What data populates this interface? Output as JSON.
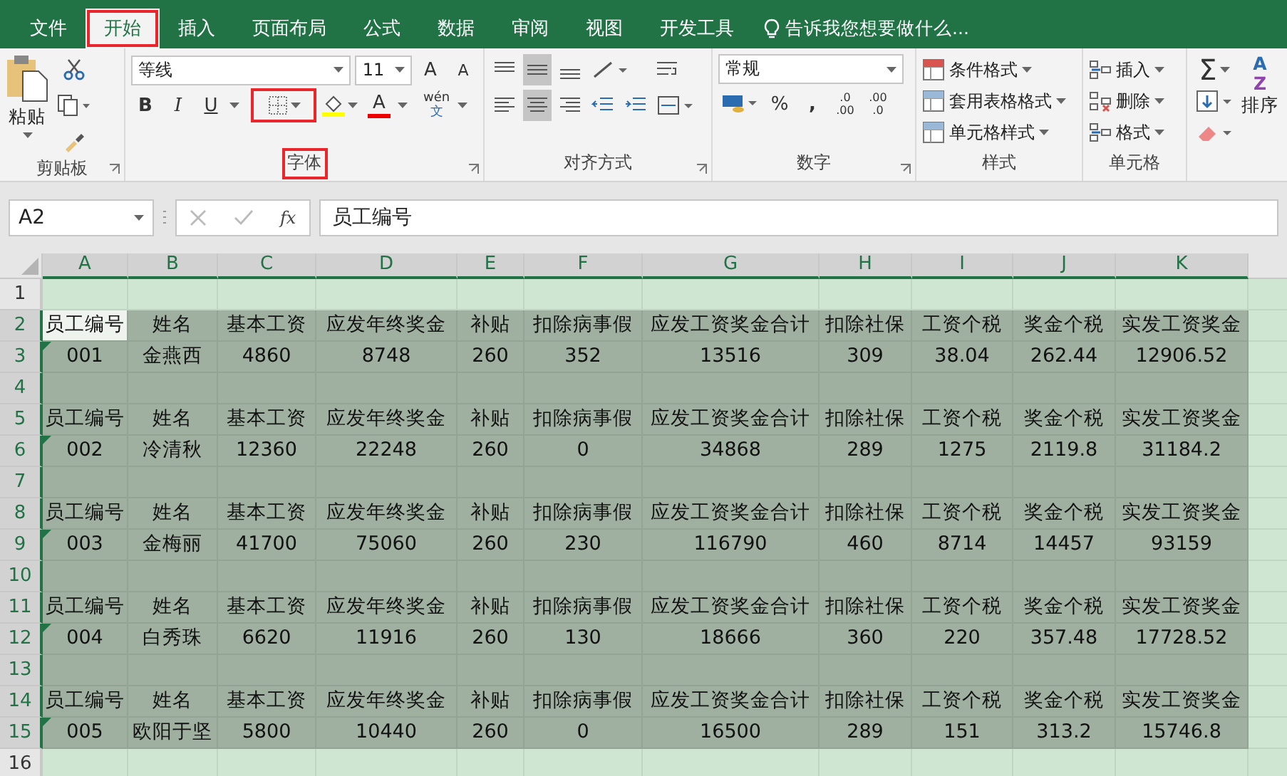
{
  "tabs": [
    {
      "label": "文件",
      "selected": false,
      "highlighted": false
    },
    {
      "label": "开始",
      "selected": true,
      "highlighted": true
    },
    {
      "label": "插入",
      "selected": false,
      "highlighted": false
    },
    {
      "label": "页面布局",
      "selected": false,
      "highlighted": false
    },
    {
      "label": "公式",
      "selected": false,
      "highlighted": false
    },
    {
      "label": "数据",
      "selected": false,
      "highlighted": false
    },
    {
      "label": "审阅",
      "selected": false,
      "highlighted": false
    },
    {
      "label": "视图",
      "selected": false,
      "highlighted": false
    },
    {
      "label": "开发工具",
      "selected": false,
      "highlighted": false
    }
  ],
  "tell_me": "告诉我您想要做什么...",
  "ribbon": {
    "clipboard": {
      "paste": "粘贴",
      "label": "剪贴板"
    },
    "font": {
      "name": "等线",
      "size": "11",
      "grow": "A",
      "shrink": "A",
      "bold": "B",
      "italic": "I",
      "underline": "U",
      "color_letter": "A",
      "phonetic_top": "wén",
      "phonetic_bottom": "文",
      "label": "字体",
      "label_highlighted": true,
      "border_highlighted": true
    },
    "alignment": {
      "label": "对齐方式"
    },
    "number": {
      "format": "常规",
      "percent": "%",
      "comma": ",",
      "increase_decimal": [
        ".0",
        ".00"
      ],
      "decrease_decimal": [
        ".00",
        ".0"
      ],
      "label": "数字"
    },
    "styles": {
      "items": [
        "条件格式",
        "套用表格格式",
        "单元格样式"
      ],
      "label": "样式"
    },
    "cells": {
      "items": [
        "插入",
        "删除",
        "格式"
      ],
      "label": "单元格"
    },
    "editing": {
      "sum": "Σ",
      "sort_icon": [
        "A",
        "Z"
      ],
      "sort": "排序"
    }
  },
  "formula_bar": {
    "name_box": "A2",
    "fx": "fx",
    "value": "员工编号"
  },
  "sheet": {
    "columns": [
      {
        "label": "A",
        "selected": true
      },
      {
        "label": "B",
        "selected": true
      },
      {
        "label": "C",
        "selected": true
      },
      {
        "label": "D",
        "selected": true
      },
      {
        "label": "E",
        "selected": true
      },
      {
        "label": "F",
        "selected": true
      },
      {
        "label": "G",
        "selected": true
      },
      {
        "label": "H",
        "selected": true
      },
      {
        "label": "I",
        "selected": true
      },
      {
        "label": "J",
        "selected": true
      },
      {
        "label": "K",
        "selected": true
      }
    ],
    "rows": [
      {
        "number": "1",
        "selected": false,
        "kind": "blank"
      },
      {
        "number": "2",
        "selected": true,
        "active": true,
        "kind": "header",
        "cells": [
          "员工编号",
          "姓名",
          "基本工资",
          "应发年终奖金",
          "补贴",
          "扣除病事假",
          "应发工资奖金合计",
          "扣除社保",
          "工资个税",
          "奖金个税",
          "实发工资奖金"
        ]
      },
      {
        "number": "3",
        "selected": true,
        "kind": "data",
        "cells": [
          "001",
          "金燕西",
          "4860",
          "8748",
          "260",
          "352",
          "13516",
          "309",
          "38.04",
          "262.44",
          "12906.52"
        ]
      },
      {
        "number": "4",
        "selected": true,
        "kind": "blank"
      },
      {
        "number": "5",
        "selected": true,
        "kind": "header",
        "cells": [
          "员工编号",
          "姓名",
          "基本工资",
          "应发年终奖金",
          "补贴",
          "扣除病事假",
          "应发工资奖金合计",
          "扣除社保",
          "工资个税",
          "奖金个税",
          "实发工资奖金"
        ]
      },
      {
        "number": "6",
        "selected": true,
        "kind": "data",
        "cells": [
          "002",
          "冷清秋",
          "12360",
          "22248",
          "260",
          "0",
          "34868",
          "289",
          "1275",
          "2119.8",
          "31184.2"
        ]
      },
      {
        "number": "7",
        "selected": true,
        "kind": "blank"
      },
      {
        "number": "8",
        "selected": true,
        "kind": "header",
        "cells": [
          "员工编号",
          "姓名",
          "基本工资",
          "应发年终奖金",
          "补贴",
          "扣除病事假",
          "应发工资奖金合计",
          "扣除社保",
          "工资个税",
          "奖金个税",
          "实发工资奖金"
        ]
      },
      {
        "number": "9",
        "selected": true,
        "kind": "data",
        "cells": [
          "003",
          "金梅丽",
          "41700",
          "75060",
          "260",
          "230",
          "116790",
          "460",
          "8714",
          "14457",
          "93159"
        ]
      },
      {
        "number": "10",
        "selected": true,
        "kind": "blank"
      },
      {
        "number": "11",
        "selected": true,
        "kind": "header",
        "cells": [
          "员工编号",
          "姓名",
          "基本工资",
          "应发年终奖金",
          "补贴",
          "扣除病事假",
          "应发工资奖金合计",
          "扣除社保",
          "工资个税",
          "奖金个税",
          "实发工资奖金"
        ]
      },
      {
        "number": "12",
        "selected": true,
        "kind": "data",
        "cells": [
          "004",
          "白秀珠",
          "6620",
          "11916",
          "260",
          "130",
          "18666",
          "360",
          "220",
          "357.48",
          "17728.52"
        ]
      },
      {
        "number": "13",
        "selected": true,
        "kind": "blank"
      },
      {
        "number": "14",
        "selected": true,
        "kind": "header",
        "cells": [
          "员工编号",
          "姓名",
          "基本工资",
          "应发年终奖金",
          "补贴",
          "扣除病事假",
          "应发工资奖金合计",
          "扣除社保",
          "工资个税",
          "奖金个税",
          "实发工资奖金"
        ]
      },
      {
        "number": "15",
        "selected": true,
        "kind": "data",
        "cells": [
          "005",
          "欧阳于坚",
          "5800",
          "10440",
          "260",
          "0",
          "16500",
          "289",
          "151",
          "313.2",
          "15746.8"
        ]
      },
      {
        "number": "16",
        "selected": false,
        "kind": "blank"
      }
    ]
  }
}
